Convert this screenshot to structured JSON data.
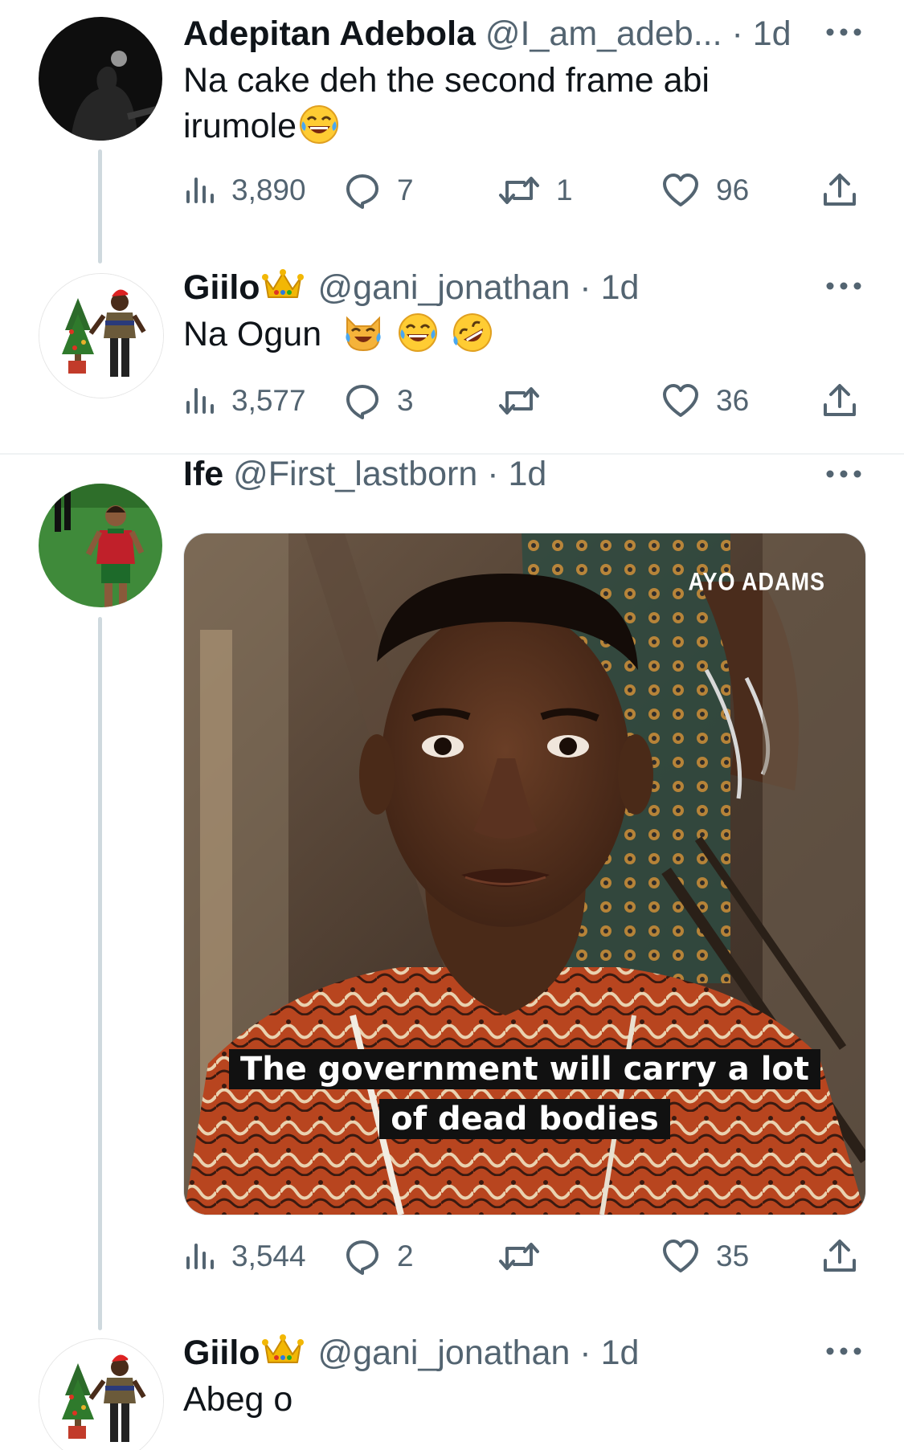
{
  "tweets": [
    {
      "name": "Adepitan Adebola",
      "meta": "@I_am_adeb... · 1d",
      "text": "Na cake deh the second frame  abi irumole",
      "text_line1": "Na cake deh the second frame  abi",
      "text_line2": "irumole",
      "emojis": [
        "face-with-tears-of-joy"
      ],
      "views": "3,890",
      "replies": "7",
      "retweets": "1",
      "likes": "96"
    },
    {
      "name": "Giilo",
      "name_emoji": "crown",
      "meta": "@gani_jonathan · 1d",
      "text": "Na Ogun",
      "emojis": [
        "crying-cat-face",
        "face-with-tears-of-joy",
        "rolling-on-the-floor-laughing"
      ],
      "views": "3,577",
      "replies": "3",
      "retweets": "",
      "likes": "36"
    },
    {
      "name": "Ife",
      "meta": "@First_lastborn · 1d",
      "media": {
        "watermark": "AYO ADAMS",
        "caption_line1": "The government will carry a lot",
        "caption_line2": "of dead bodies"
      },
      "views": "3,544",
      "replies": "2",
      "retweets": "",
      "likes": "35"
    },
    {
      "name": "Giilo",
      "name_emoji": "crown",
      "meta": "@gani_jonathan · 1d",
      "text": "Abeg o"
    }
  ],
  "colors": {
    "text": "#0f1419",
    "muted": "#536471",
    "thread_line": "#cfd9de",
    "divider": "#eff3f4"
  },
  "icons": [
    "views-icon",
    "reply-icon",
    "retweet-icon",
    "like-icon",
    "share-icon",
    "more-icon",
    "crown-emoji",
    "laughing-emoji"
  ]
}
